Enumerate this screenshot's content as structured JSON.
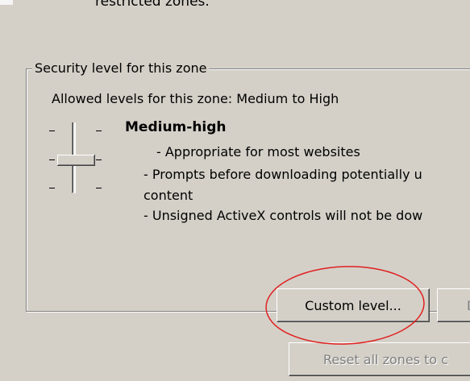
{
  "header_text": "restricted zones.",
  "security_group": {
    "legend": "Security level for this zone",
    "allowed_levels": "Allowed levels for this zone: Medium to High",
    "level_title": "Medium-high",
    "descriptions": [
      "- Appropriate for most websites",
      "- Prompts before downloading potentially u",
      "content",
      "- Unsigned ActiveX controls will not be dow"
    ],
    "slider_level": "Medium-high"
  },
  "buttons": {
    "custom_level": "Custom level...",
    "default_level": "D",
    "reset_all": "Reset all zones to c"
  },
  "annotation": {
    "highlight_color": "#e02020"
  }
}
